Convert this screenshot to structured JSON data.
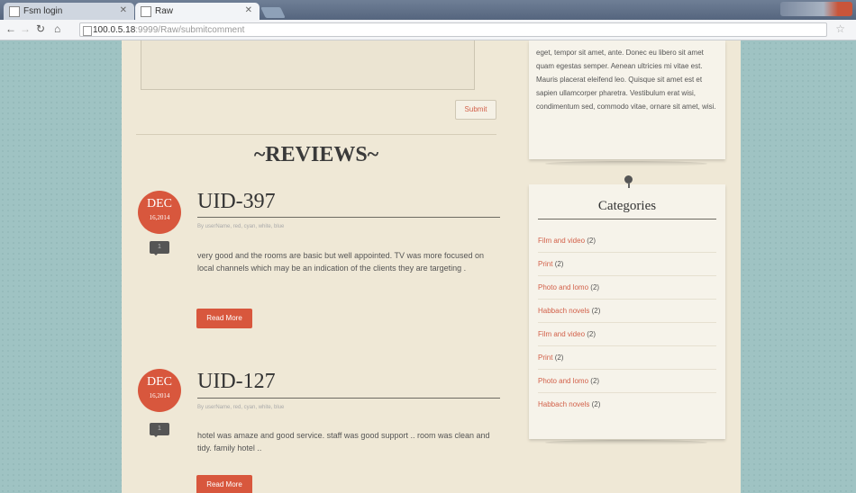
{
  "browser": {
    "tabs": [
      {
        "title": "Fsm login"
      },
      {
        "title": "Raw"
      }
    ],
    "address": {
      "host": "100.0.5.18",
      "path": ":9999/Raw/submitcomment"
    }
  },
  "form": {
    "submit_label": "Submit"
  },
  "reviews": {
    "heading": "~REVIEWS~",
    "items": [
      {
        "month": "DEC",
        "date": "16,2014",
        "comment_count": "1",
        "title": "UID-397",
        "meta": "By userName, red, cyan, white, blue",
        "text": "very good and the rooms are basic but well appointed. TV was more focused on local channels which may be an indication of the clients they are targeting .",
        "read_more": "Read More"
      },
      {
        "month": "DEC",
        "date": "16,2014",
        "comment_count": "1",
        "title": "UID-127",
        "meta": "By userName, red, cyan, white, blue",
        "text": "hotel was amaze and good service. staff was good support .. room was clean and tidy. family hotel ..",
        "read_more": "Read More"
      }
    ]
  },
  "sidebar": {
    "about_text": "eget, tempor sit amet, ante. Donec eu libero sit amet quam egestas semper. Aenean ultricies mi vitae est. Mauris placerat eleifend leo. Quisque sit amet est et sapien ullamcorper pharetra. Vestibulum erat wisi, condimentum sed, commodo vitae, ornare sit amet, wisi.",
    "categories_title": "Categories",
    "categories": [
      {
        "name": "Film and video",
        "count": "(2)"
      },
      {
        "name": "Print",
        "count": "(2)"
      },
      {
        "name": "Photo and lomo",
        "count": "(2)"
      },
      {
        "name": "Habbach novels",
        "count": "(2)"
      },
      {
        "name": "Film and video",
        "count": "(2)"
      },
      {
        "name": "Print",
        "count": "(2)"
      },
      {
        "name": "Photo and lomo",
        "count": "(2)"
      },
      {
        "name": "Habbach novels",
        "count": "(2)"
      }
    ]
  },
  "colors": {
    "accent": "#d8573d",
    "page_bg": "#efe8d6",
    "outer_bg": "#9fc3c3"
  }
}
